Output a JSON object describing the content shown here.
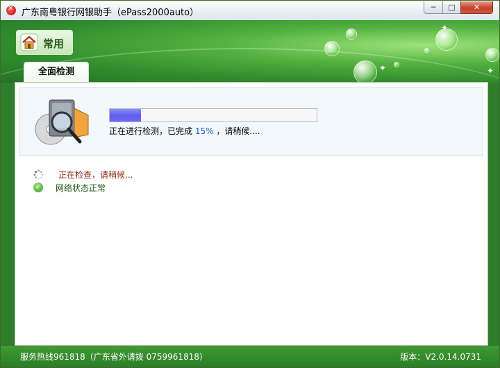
{
  "window": {
    "title": "广东南粤银行网银助手（ePass2000auto）",
    "controls": {
      "minimize": "─",
      "maximize": "□",
      "close": "✕"
    }
  },
  "header": {
    "home_label": "常用",
    "tab_label": "全面检测"
  },
  "progress": {
    "percent": 15,
    "text_before": "正在进行检测，已完成",
    "percent_text": "15%",
    "text_after": "，请稍候...."
  },
  "status": [
    {
      "icon": "spinner-icon",
      "text": "正在检查，请稍候..."
    },
    {
      "icon": "check-circle-icon",
      "text": "网络状态正常"
    }
  ],
  "footer": {
    "hotline": "服务热线961818（广东省外请拨 0759961818）",
    "version": "版本：V2.0.14.0731"
  },
  "colors": {
    "progress_fill": "#5d5df0",
    "header_green": "#2f8b2c",
    "footer_green": "#2a7d26"
  }
}
